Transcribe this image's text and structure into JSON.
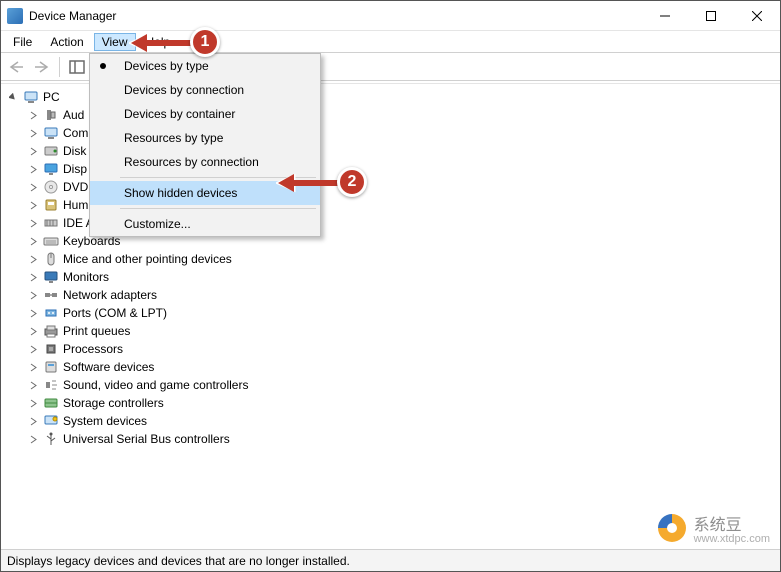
{
  "window": {
    "title": "Device Manager"
  },
  "menubar": {
    "items": [
      {
        "label": "File"
      },
      {
        "label": "Action"
      },
      {
        "label": "View"
      },
      {
        "label": "Help"
      }
    ],
    "open_index": 2
  },
  "dropdown": {
    "items": [
      {
        "label": "Devices by type",
        "bullet": true
      },
      {
        "label": "Devices by connection"
      },
      {
        "label": "Devices by container"
      },
      {
        "label": "Resources by type"
      },
      {
        "label": "Resources by connection"
      },
      {
        "sep": true
      },
      {
        "label": "Show hidden devices",
        "highlight": true
      },
      {
        "sep": true
      },
      {
        "label": "Customize..."
      }
    ]
  },
  "tree": {
    "root": {
      "label": "PC",
      "icon": "computer-icon"
    },
    "categories": [
      {
        "label": "Audio inputs and outputs",
        "truncated": "Aud",
        "icon": "speaker-icon"
      },
      {
        "label": "Computer",
        "truncated": "Com",
        "icon": "computer-icon"
      },
      {
        "label": "Disk drives",
        "truncated": "Disk",
        "icon": "disk-icon"
      },
      {
        "label": "Display adapters",
        "truncated": "Disp",
        "icon": "display-icon"
      },
      {
        "label": "DVD/CD-ROM drives",
        "truncated": "DVD",
        "icon": "cd-icon"
      },
      {
        "label": "Human Interface Devices",
        "truncated": "Hum",
        "icon": "hid-icon"
      },
      {
        "label": "IDE ATA/ATAPI controllers",
        "truncated": "IDE A",
        "icon": "ide-icon"
      },
      {
        "label": "Keyboards",
        "icon": "keyboard-icon"
      },
      {
        "label": "Mice and other pointing devices",
        "icon": "mouse-icon"
      },
      {
        "label": "Monitors",
        "icon": "monitor-icon"
      },
      {
        "label": "Network adapters",
        "icon": "network-icon"
      },
      {
        "label": "Ports (COM & LPT)",
        "icon": "port-icon"
      },
      {
        "label": "Print queues",
        "icon": "printer-icon"
      },
      {
        "label": "Processors",
        "icon": "cpu-icon"
      },
      {
        "label": "Software devices",
        "icon": "software-icon"
      },
      {
        "label": "Sound, video and game controllers",
        "icon": "sound-icon"
      },
      {
        "label": "Storage controllers",
        "icon": "storage-icon"
      },
      {
        "label": "System devices",
        "icon": "system-icon"
      },
      {
        "label": "Universal Serial Bus controllers",
        "icon": "usb-icon"
      }
    ]
  },
  "statusbar": {
    "text": "Displays legacy devices and devices that are no longer installed."
  },
  "annotations": {
    "badge1": "1",
    "badge2": "2"
  },
  "watermark": {
    "name": "系统豆",
    "url": "www.xtdpc.com"
  }
}
